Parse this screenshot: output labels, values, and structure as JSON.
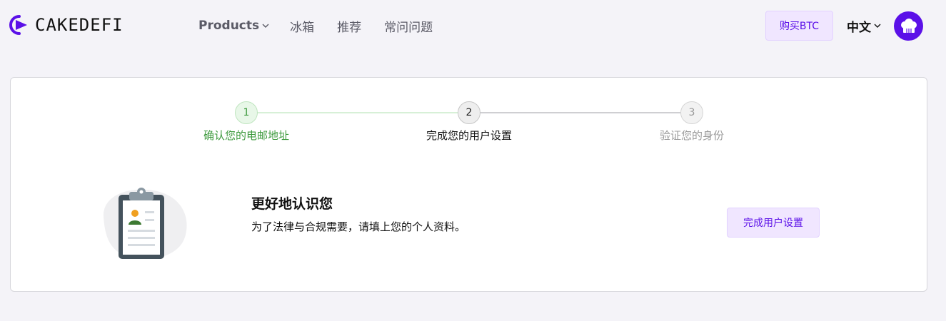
{
  "header": {
    "logo": {
      "part1": "CAKE",
      "part2": "DEFI"
    },
    "nav": [
      {
        "label": "Products",
        "has_dropdown": true
      },
      {
        "label": "冰箱"
      },
      {
        "label": "推荐"
      },
      {
        "label": "常问问题"
      }
    ],
    "buy_button": "购买BTC",
    "language": "中文"
  },
  "stepper": {
    "steps": [
      {
        "number": "1",
        "label": "确认您的电邮地址",
        "state": "done"
      },
      {
        "number": "2",
        "label": "完成您的用户设置",
        "state": "current"
      },
      {
        "number": "3",
        "label": "验证您的身份",
        "state": "upcoming"
      }
    ]
  },
  "info": {
    "title": "更好地认识您",
    "description": "为了法律与合规需要，请填上您的个人资料。",
    "button": "完成用户设置"
  },
  "colors": {
    "brand": "#5b10e8",
    "button_bg": "#f0e6ff",
    "success": "#3d9a3d",
    "page_bg": "#f4f3f8"
  },
  "icons": {
    "logo": "play-logo-icon",
    "dropdown": "chevron-down-icon",
    "avatar": "chef-hat-icon",
    "illustration": "clipboard-profile-icon"
  }
}
